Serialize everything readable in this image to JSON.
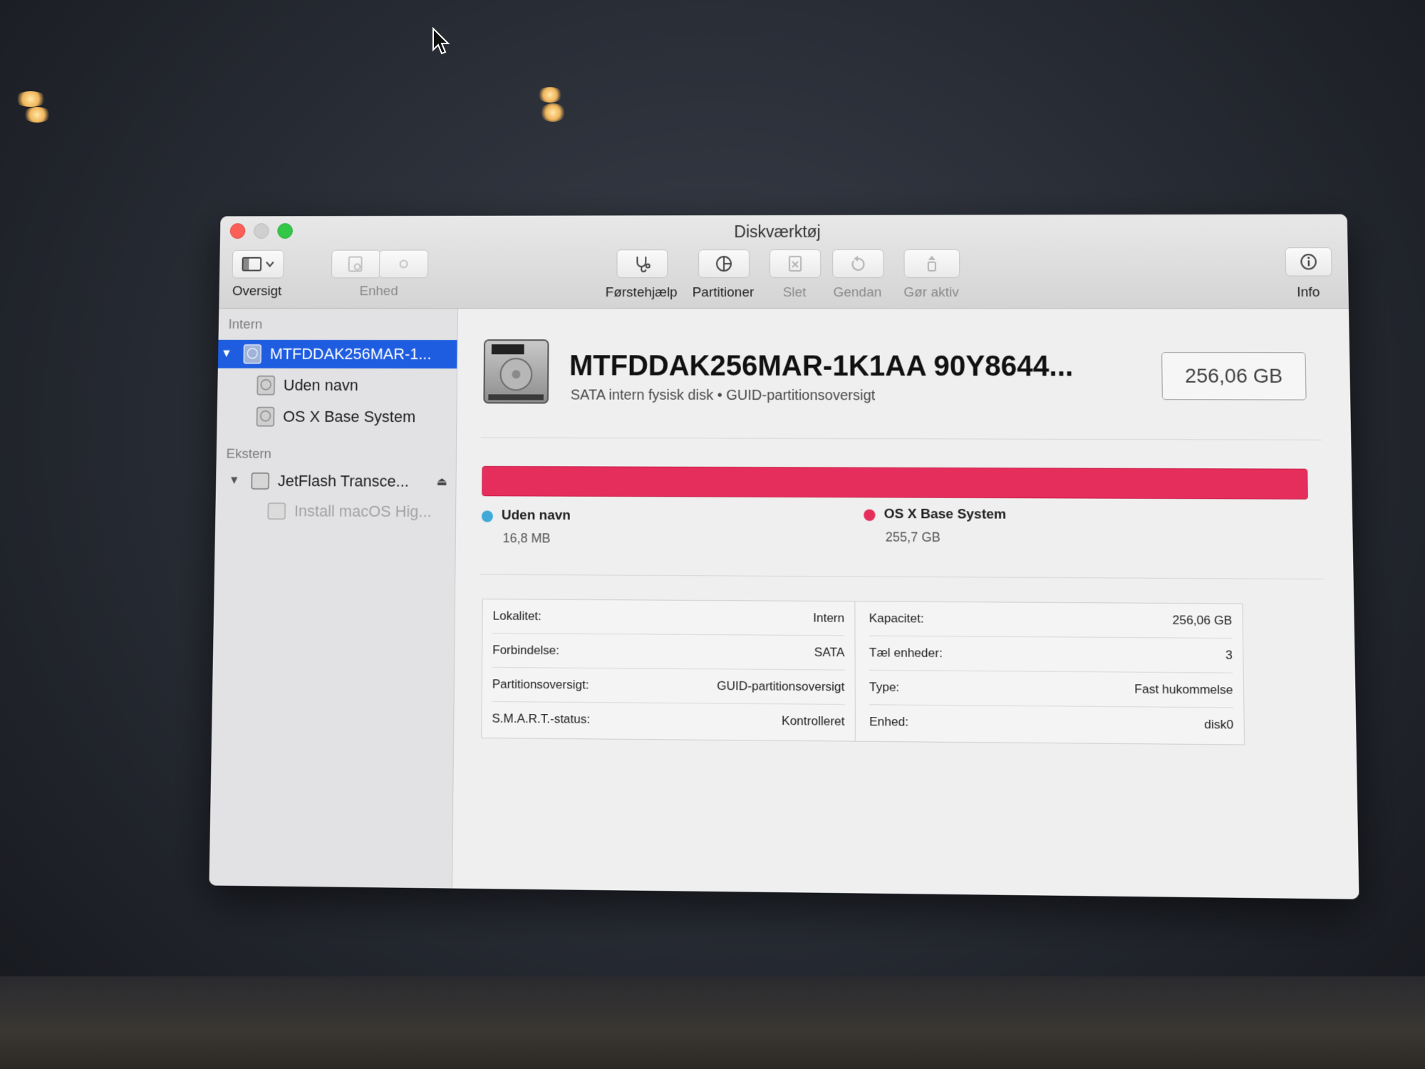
{
  "window": {
    "title": "Diskværktøj"
  },
  "toolbar": {
    "overview_label": "Oversigt",
    "device_label": "Enhed",
    "firstaid_label": "Førstehjælp",
    "partition_label": "Partitioner",
    "erase_label": "Slet",
    "restore_label": "Gendan",
    "mount_label": "Gør aktiv",
    "info_label": "Info"
  },
  "sidebar": {
    "internal_header": "Intern",
    "external_header": "Ekstern",
    "internal_disk": "MTFDDAK256MAR-1...",
    "internal_volumes": [
      "Uden navn",
      "OS X Base System"
    ],
    "external_disk": "JetFlash Transce...",
    "external_volume": "Install macOS Hig..."
  },
  "disk": {
    "title": "MTFDDAK256MAR-1K1AA 90Y8644...",
    "subtitle": "SATA intern fysisk disk • GUID-partitionsoversigt",
    "capacity": "256,06 GB"
  },
  "partitions": [
    {
      "name": "Uden navn",
      "size": "16,8 MB",
      "color": "#3fa9d8",
      "fraction": 0.0001
    },
    {
      "name": "OS X Base System",
      "size": "255,7 GB",
      "color": "#e62e5c",
      "fraction": 0.9999
    }
  ],
  "info": {
    "left": [
      {
        "label": "Lokalitet:",
        "value": "Intern"
      },
      {
        "label": "Forbindelse:",
        "value": "SATA"
      },
      {
        "label": "Partitionsoversigt:",
        "value": "GUID-partitionsoversigt"
      },
      {
        "label": "S.M.A.R.T.-status:",
        "value": "Kontrolleret"
      }
    ],
    "right": [
      {
        "label": "Kapacitet:",
        "value": "256,06 GB"
      },
      {
        "label": "Tæl enheder:",
        "value": "3"
      },
      {
        "label": "Type:",
        "value": "Fast hukommelse"
      },
      {
        "label": "Enhed:",
        "value": "disk0"
      }
    ]
  }
}
